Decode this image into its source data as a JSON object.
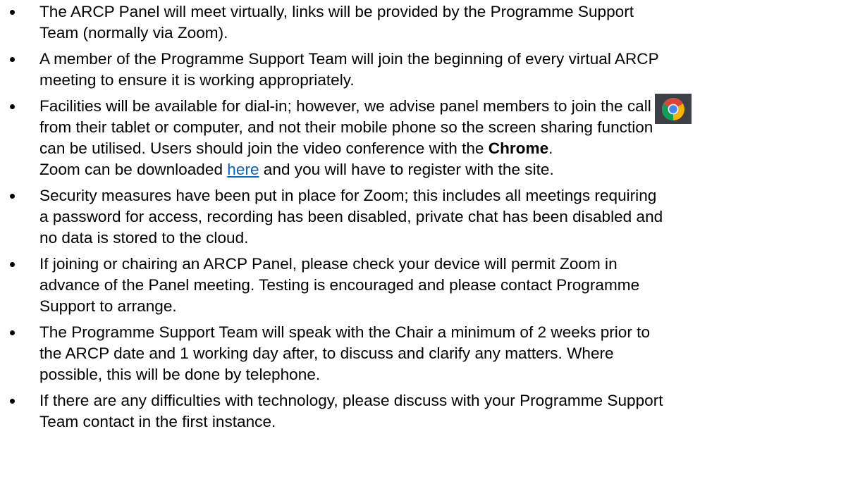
{
  "bullets": [
    {
      "lines": [
        "The ARCP Panel will meet virtually, links will be provided by the Programme Support",
        "Team (normally via Zoom)."
      ]
    },
    {
      "lines": [
        "A member of the Programme Support Team will join the beginning of every virtual ARCP",
        "meeting to ensure it is working appropriately."
      ]
    },
    {
      "line1": "Facilities will be available for dial-in; however, we advise panel members to join the call",
      "line2": "from their tablet or computer, and not their mobile phone so the screen sharing function",
      "line3_pre": "can be utilised. Users should join the video conference with the ",
      "line3_bold": "Chrome",
      "line3_post": ".",
      "line4_pre": "Zoom can be downloaded ",
      "link_text": "here",
      "line4_post": " and you will have to register with the site."
    },
    {
      "lines": [
        "Security measures have been put in place for Zoom; this includes all meetings requiring",
        "a password for access, recording has been disabled, private chat has been disabled and",
        "no data is stored to the cloud."
      ]
    },
    {
      "lines": [
        "If joining or chairing an ARCP Panel, please check your device will permit Zoom in",
        "advance of the Panel meeting. Testing is encouraged and please contact Programme",
        "Support to arrange."
      ]
    },
    {
      "lines": [
        "The Programme Support Team will speak with the Chair a minimum of 2 weeks prior to",
        "the ARCP date and 1 working day after, to discuss and clarify any matters. Where",
        "possible, this will be done by telephone."
      ]
    },
    {
      "lines": [
        "If there are any difficulties with technology, please discuss with your Programme Support",
        "Team contact in the first instance."
      ]
    }
  ],
  "icons": {
    "chrome": "chrome-icon"
  },
  "colors": {
    "link": "#0563c1",
    "chrome_red": "#db4437",
    "chrome_yellow": "#f4b400",
    "chrome_green": "#0f9d58",
    "chrome_blue": "#4285f4",
    "badge_bg": "#3c3f45"
  }
}
